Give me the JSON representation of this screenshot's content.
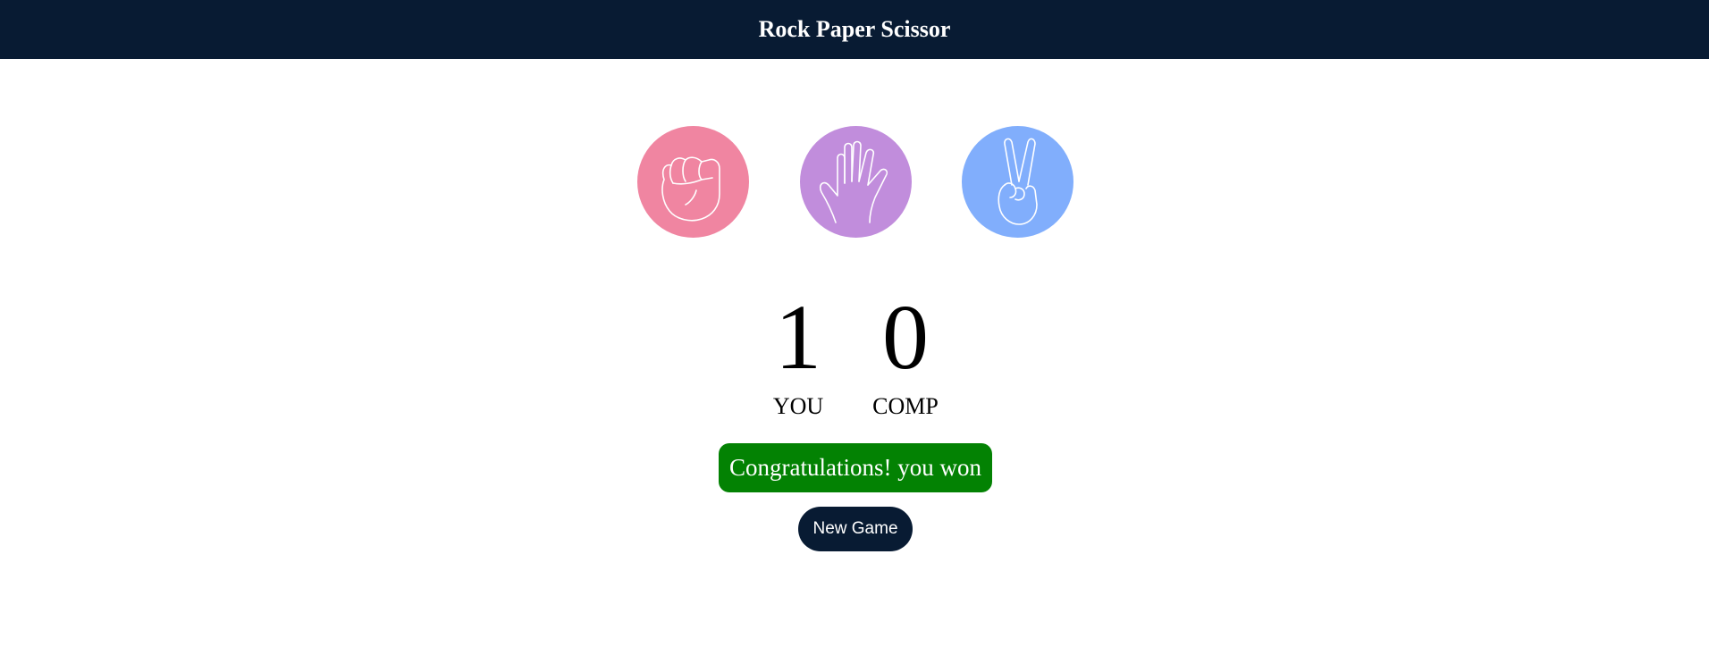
{
  "header": {
    "title": "Rock Paper Scissor"
  },
  "choices": [
    {
      "id": "rock",
      "icon": "fist-icon",
      "color": "#f085a1"
    },
    {
      "id": "paper",
      "icon": "open-hand-icon",
      "color": "#c18ddc"
    },
    {
      "id": "scissor",
      "icon": "peace-hand-icon",
      "color": "#81aefc"
    }
  ],
  "scoreboard": {
    "user": {
      "score": "1",
      "label": "YOU"
    },
    "comp": {
      "score": "0",
      "label": "COMP"
    }
  },
  "message": {
    "text": "Congratulations! you won",
    "color": "#038203"
  },
  "new_game": {
    "label": "New Game",
    "color": "#081b33"
  }
}
